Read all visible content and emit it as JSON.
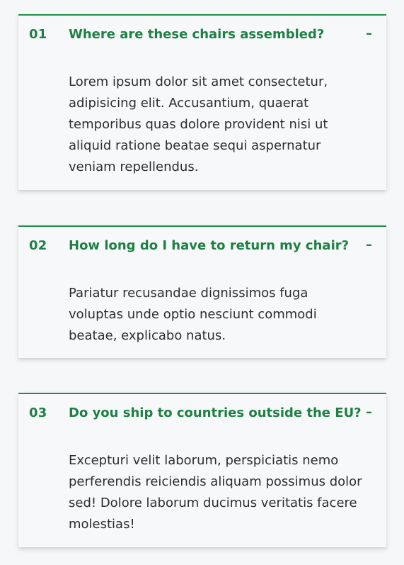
{
  "faqs": [
    {
      "number": "01",
      "question": "Where are these chairs assembled?",
      "toggle": "–",
      "answer": "Lorem ipsum dolor sit amet consectetur, adipisicing elit. Accusantium, quaerat temporibus quas dolore provident nisi ut aliquid ratione beatae sequi aspernatur veniam repellendus."
    },
    {
      "number": "02",
      "question": "How long do I have to return my chair?",
      "toggle": "–",
      "answer": "Pariatur recusandae dignissimos fuga voluptas unde optio nesciunt commodi beatae, explicabo natus."
    },
    {
      "number": "03",
      "question": "Do you ship to countries outside the EU?",
      "toggle": "–",
      "answer": "Excepturi velit laborum, perspiciatis nemo perferendis reiciendis aliquam possimus dolor sed! Dolore laborum ducimus veritatis facere molestias!"
    }
  ],
  "colors": {
    "accent": "#1e8044",
    "border": "#218f4a",
    "text": "#2d2d2d",
    "background": "#f6f7f9"
  }
}
